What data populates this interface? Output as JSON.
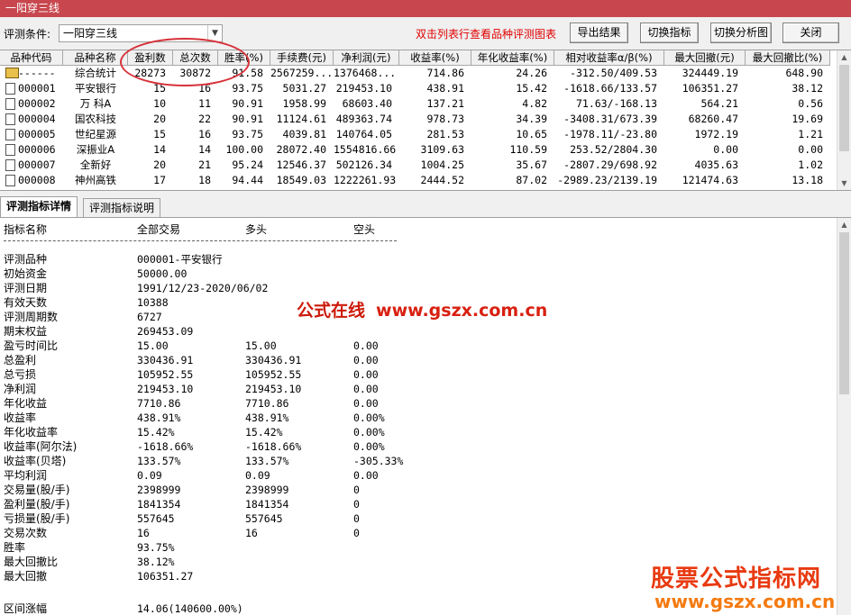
{
  "window": {
    "title": "一阳穿三线"
  },
  "toolbar": {
    "condition_label": "评测条件:",
    "condition_value": "一阳穿三线",
    "hint": "双击列表行查看品种评测图表",
    "export_label": "导出结果",
    "switch_indicator_label": "切换指标",
    "switch_chart_label": "切换分析图",
    "close_label": "关闭"
  },
  "grid": {
    "headers": [
      "品种代码",
      "品种名称",
      "盈利数",
      "总次数",
      "胜率(%)",
      "手续费(元)",
      "净利润(元)",
      "收益率(%)",
      "年化收益率(%)",
      "相对收益率α/β(%)",
      "最大回撤(元)",
      "最大回撤比(%)"
    ],
    "rows": [
      {
        "code": "------",
        "name": "综合统计",
        "win": "28273",
        "total": "30872",
        "rate": "91.58",
        "fee": "2567259...",
        "profit": "1376468...",
        "ret": "714.86",
        "annual": "24.26",
        "alpha": "-312.50/409.53",
        "dd": "324449.19",
        "ddr": "648.90"
      },
      {
        "code": "000001",
        "name": "平安银行",
        "win": "15",
        "total": "16",
        "rate": "93.75",
        "fee": "5031.27",
        "profit": "219453.10",
        "ret": "438.91",
        "annual": "15.42",
        "alpha": "-1618.66/133.57",
        "dd": "106351.27",
        "ddr": "38.12"
      },
      {
        "code": "000002",
        "name": "万 科A",
        "win": "10",
        "total": "11",
        "rate": "90.91",
        "fee": "1958.99",
        "profit": "68603.40",
        "ret": "137.21",
        "annual": "4.82",
        "alpha": "71.63/-168.13",
        "dd": "564.21",
        "ddr": "0.56"
      },
      {
        "code": "000004",
        "name": "国农科技",
        "win": "20",
        "total": "22",
        "rate": "90.91",
        "fee": "11124.61",
        "profit": "489363.74",
        "ret": "978.73",
        "annual": "34.39",
        "alpha": "-3408.31/673.39",
        "dd": "68260.47",
        "ddr": "19.69"
      },
      {
        "code": "000005",
        "name": "世纪星源",
        "win": "15",
        "total": "16",
        "rate": "93.75",
        "fee": "4039.81",
        "profit": "140764.05",
        "ret": "281.53",
        "annual": "10.65",
        "alpha": "-1978.11/-23.80",
        "dd": "1972.19",
        "ddr": "1.21"
      },
      {
        "code": "000006",
        "name": "深振业A",
        "win": "14",
        "total": "14",
        "rate": "100.00",
        "fee": "28072.40",
        "profit": "1554816.66",
        "ret": "3109.63",
        "annual": "110.59",
        "alpha": "253.52/2804.30",
        "dd": "0.00",
        "ddr": "0.00"
      },
      {
        "code": "000007",
        "name": "全新好",
        "win": "20",
        "total": "21",
        "rate": "95.24",
        "fee": "12546.37",
        "profit": "502126.34",
        "ret": "1004.25",
        "annual": "35.67",
        "alpha": "-2807.29/698.92",
        "dd": "4035.63",
        "ddr": "1.02"
      },
      {
        "code": "000008",
        "name": "神州高铁",
        "win": "17",
        "total": "18",
        "rate": "94.44",
        "fee": "18549.03",
        "profit": "1222261.93",
        "ret": "2444.52",
        "annual": "87.02",
        "alpha": "-2989.23/2139.19",
        "dd": "121474.63",
        "ddr": "13.18"
      }
    ]
  },
  "tabs": [
    "评测指标详情",
    "评测指标说明"
  ],
  "detail": {
    "header": [
      "指标名称",
      "全部交易",
      "多头",
      "空头"
    ],
    "rows": [
      [
        "评测品种",
        "000001-平安银行",
        "",
        ""
      ],
      [
        "初始资金",
        "50000.00",
        "",
        ""
      ],
      [
        "评测日期",
        "1991/12/23-2020/06/02",
        "",
        ""
      ],
      [
        "有效天数",
        "10388",
        "",
        ""
      ],
      [
        "评测周期数",
        "6727",
        "",
        ""
      ],
      [
        "期末权益",
        "269453.09",
        "",
        ""
      ],
      [
        "盈亏时间比",
        "15.00",
        "15.00",
        "0.00"
      ],
      [
        "总盈利",
        "330436.91",
        "330436.91",
        "0.00"
      ],
      [
        "总亏损",
        "105952.55",
        "105952.55",
        "0.00"
      ],
      [
        "净利润",
        "219453.10",
        "219453.10",
        "0.00"
      ],
      [
        "年化收益",
        "7710.86",
        "7710.86",
        "0.00"
      ],
      [
        "收益率",
        "438.91%",
        "438.91%",
        "0.00%"
      ],
      [
        "年化收益率",
        "15.42%",
        "15.42%",
        "0.00%"
      ],
      [
        "收益率(阿尔法)",
        "-1618.66%",
        "-1618.66%",
        "0.00%"
      ],
      [
        "收益率(贝塔)",
        "133.57%",
        "133.57%",
        "-305.33%"
      ],
      [
        "平均利润",
        "0.09",
        "0.09",
        "0.00"
      ],
      [
        "交易量(股/手)",
        "2398999",
        "2398999",
        "0"
      ],
      [
        "盈利量(股/手)",
        "1841354",
        "1841354",
        "0"
      ],
      [
        "亏损量(股/手)",
        "557645",
        "557645",
        "0"
      ],
      [
        "交易次数",
        "16",
        "16",
        "0"
      ],
      [
        "胜率",
        "93.75%",
        "",
        ""
      ],
      [
        "最大回撤比",
        "38.12%",
        "",
        ""
      ],
      [
        "最大回撤",
        "106351.27",
        "",
        ""
      ]
    ],
    "footer": [
      "区间涨幅",
      "14.06(140600.00%)"
    ]
  },
  "watermarks": {
    "center_text": "公式在线",
    "center_url": "www.gszx.com.cn",
    "corner_title": "股票公式指标网",
    "corner_url": "www.gszx.com.cn"
  },
  "colors": {
    "titlebar": "#c8474e",
    "hint": "#e00000",
    "highlight_circle": "#d7323a"
  }
}
